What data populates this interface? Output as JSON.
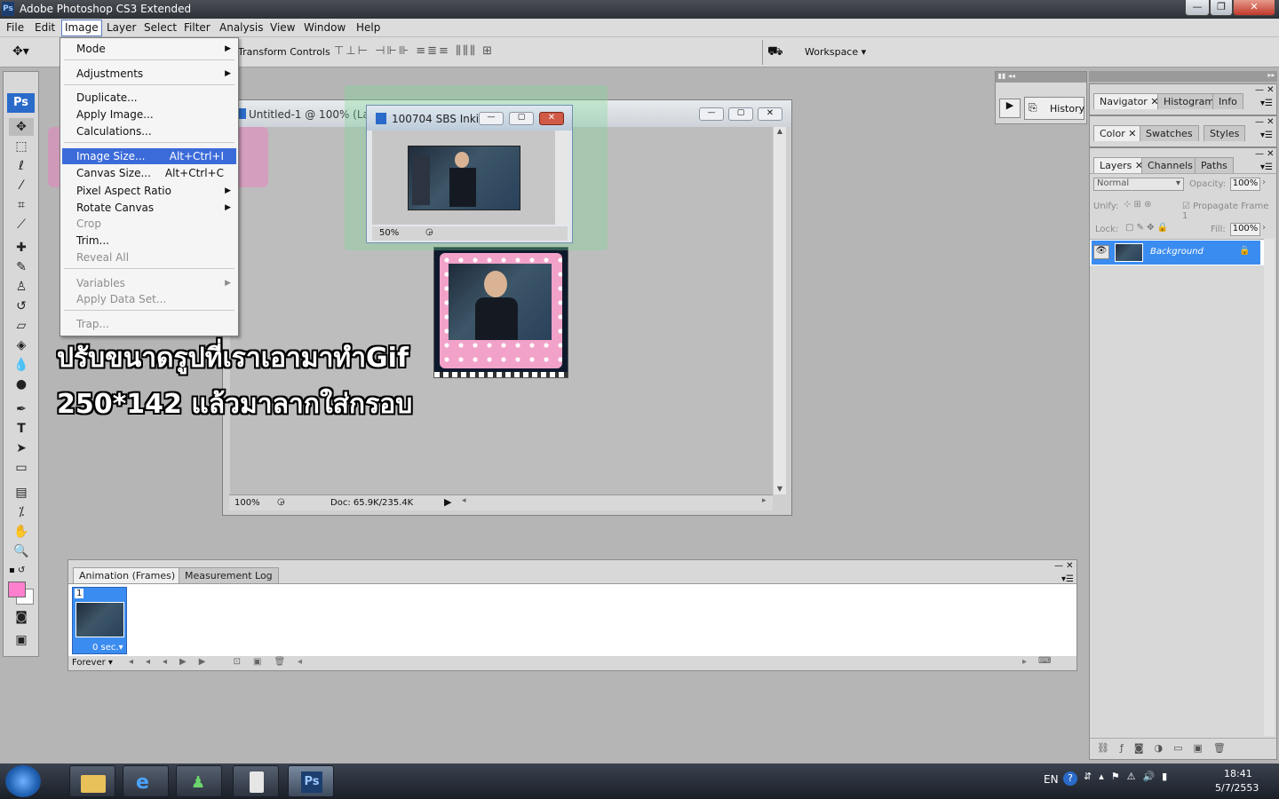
{
  "app": {
    "title": "Adobe Photoshop CS3 Extended",
    "logo": "Ps"
  },
  "menubar": [
    "File",
    "Edit",
    "Image",
    "Layer",
    "Select",
    "Filter",
    "Analysis",
    "View",
    "Window",
    "Help"
  ],
  "options_bar": {
    "transform_controls": "Transform Controls",
    "workspace": "Workspace"
  },
  "image_menu": {
    "items": [
      {
        "label": "Mode",
        "submenu": true
      },
      {
        "label": "Adjustments",
        "submenu": true
      },
      {
        "label": "Duplicate..."
      },
      {
        "label": "Apply Image..."
      },
      {
        "label": "Calculations..."
      },
      {
        "label": "Image Size...",
        "shortcut": "Alt+Ctrl+I",
        "selected": true
      },
      {
        "label": "Canvas Size...",
        "shortcut": "Alt+Ctrl+C"
      },
      {
        "label": "Pixel Aspect Ratio",
        "submenu": true
      },
      {
        "label": "Rotate Canvas",
        "submenu": true
      },
      {
        "label": "Crop",
        "disabled": true
      },
      {
        "label": "Trim..."
      },
      {
        "label": "Reveal All",
        "disabled": true
      },
      {
        "label": "Variables",
        "submenu": true,
        "disabled": true
      },
      {
        "label": "Apply Data Set...",
        "disabled": true
      },
      {
        "label": "Trap...",
        "disabled": true
      }
    ]
  },
  "documents": {
    "main": {
      "title": "Untitled-1 @ 100% (Layer",
      "zoom": "100%",
      "doc_info": "Doc: 65.9K/235.4K"
    },
    "secondary": {
      "title": "100704 SBS Inki...",
      "zoom": "50%"
    }
  },
  "overlay_text": {
    "line1": "ปรับขนาดรูปที่เราเอามาทำGif",
    "line2": "250*142 แล้วมาลากใส่กรอบ"
  },
  "history_panel": {
    "label": "History"
  },
  "panels": {
    "nav_tabs": [
      "Navigator",
      "Histogram",
      "Info"
    ],
    "color_tabs": [
      "Color",
      "Swatches",
      "Styles"
    ],
    "layer_tabs": [
      "Layers",
      "Channels",
      "Paths"
    ],
    "blend_mode": "Normal",
    "opacity_label": "Opacity:",
    "opacity_value": "100%",
    "unify_label": "Unify:",
    "propagate_label": "Propagate Frame 1",
    "lock_label": "Lock:",
    "fill_label": "Fill:",
    "fill_value": "100%",
    "layer_name": "Background"
  },
  "animation": {
    "tabs": [
      "Animation (Frames)",
      "Measurement Log"
    ],
    "frame_number": "1",
    "frame_delay": "0 sec.",
    "loop": "Forever"
  },
  "taskbar": {
    "lang": "EN",
    "time": "18:41",
    "date": "5/7/2553"
  },
  "colors": {
    "foreground": "#ff7fcf",
    "selection": "#3b6bd9",
    "pink_frame": "#f4a6c9"
  }
}
